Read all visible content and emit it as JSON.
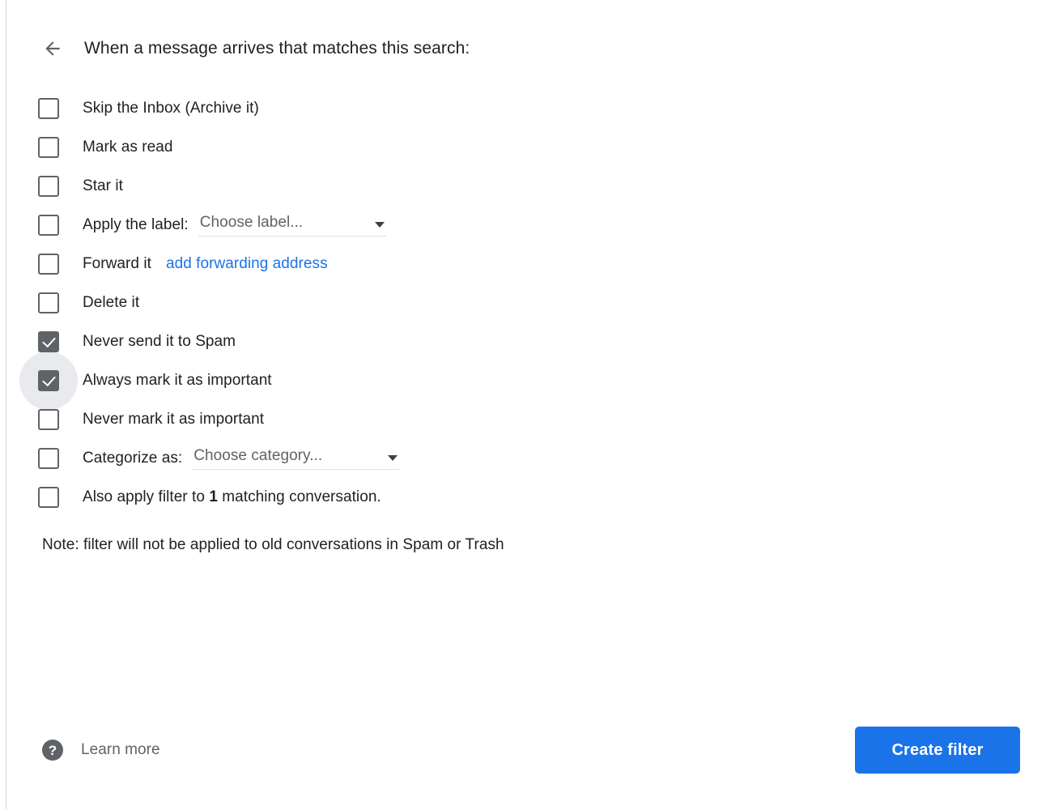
{
  "header": {
    "back_icon": "arrow-left-icon",
    "title": "When a message arrives that matches this search:"
  },
  "actions": [
    {
      "id": "skip-inbox",
      "label": "Skip the Inbox (Archive it)",
      "checked": false,
      "focused": false
    },
    {
      "id": "mark-as-read",
      "label": "Mark as read",
      "checked": false,
      "focused": false
    },
    {
      "id": "star-it",
      "label": "Star it",
      "checked": false,
      "focused": false
    },
    {
      "id": "apply-label",
      "label": "Apply the label:",
      "checked": false,
      "focused": false,
      "control": {
        "type": "dropdown",
        "value": "Choose label..."
      }
    },
    {
      "id": "forward-it",
      "label": "Forward it",
      "checked": false,
      "focused": false,
      "control": {
        "type": "link",
        "value": "add forwarding address"
      }
    },
    {
      "id": "delete-it",
      "label": "Delete it",
      "checked": false,
      "focused": false
    },
    {
      "id": "never-spam",
      "label": "Never send it to Spam",
      "checked": true,
      "focused": false
    },
    {
      "id": "always-important",
      "label": "Always mark it as important",
      "checked": true,
      "focused": true
    },
    {
      "id": "never-important",
      "label": "Never mark it as important",
      "checked": false,
      "focused": false
    },
    {
      "id": "categorize-as",
      "label": "Categorize as:",
      "checked": false,
      "focused": false,
      "control": {
        "type": "dropdown",
        "value": "Choose category..."
      }
    }
  ],
  "also_apply": {
    "checked": false,
    "prefix": "Also apply filter to",
    "count": "1",
    "suffix": "matching conversation."
  },
  "note": "Note: filter will not be applied to old conversations in Spam or Trash",
  "footer": {
    "help_icon": "help-question-icon",
    "learn_more_label": "Learn more",
    "create_button_label": "Create filter"
  },
  "colors": {
    "accent_blue": "#1a73e8",
    "link_blue": "#1a73e8",
    "checkbox_gray": "#5f6368",
    "text_primary": "#202124",
    "focus_ring": "#e8eaed"
  }
}
